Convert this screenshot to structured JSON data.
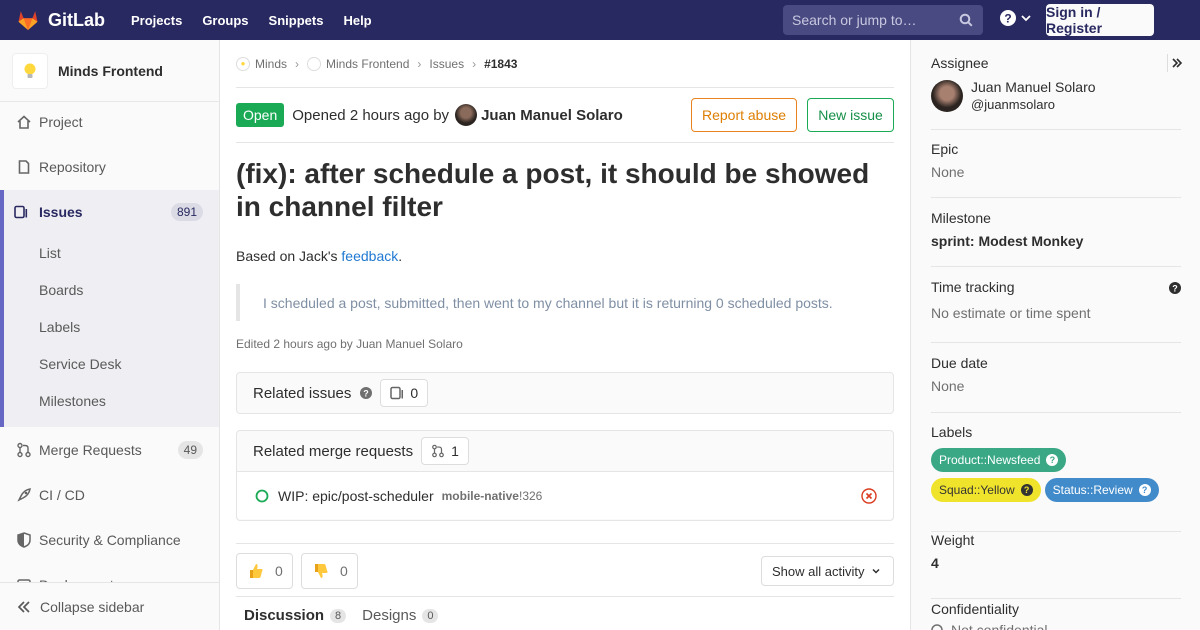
{
  "topnav": {
    "brand": "GitLab",
    "links": [
      "Projects",
      "Groups",
      "Snippets",
      "Help"
    ],
    "search_placeholder": "Search or jump to…",
    "signin_label": "Sign in / Register"
  },
  "sidebar": {
    "project_name": "Minds Frontend",
    "items": [
      {
        "label": "Project",
        "icon": "home-icon"
      },
      {
        "label": "Repository",
        "icon": "doc-icon"
      }
    ],
    "issues": {
      "label": "Issues",
      "count": "891",
      "sub": [
        "List",
        "Boards",
        "Labels",
        "Service Desk",
        "Milestones"
      ]
    },
    "after": [
      {
        "label": "Merge Requests",
        "count": "49"
      },
      {
        "label": "CI / CD"
      },
      {
        "label": "Security & Compliance"
      },
      {
        "label": "Deployments"
      }
    ],
    "collapse_label": "Collapse sidebar"
  },
  "breadcrumb": {
    "group": "Minds",
    "project": "Minds Frontend",
    "section": "Issues",
    "current": "#1843"
  },
  "issue": {
    "status": "Open",
    "opened_text": "Opened",
    "opened_time": "2 hours ago",
    "by_text": "by",
    "author": "Juan Manuel Solaro",
    "report_label": "Report abuse",
    "new_label": "New issue",
    "title": "(fix): after schedule a post, it should be showed in channel filter",
    "desc_prefix": "Based on Jack's ",
    "desc_link": "feedback",
    "desc_suffix": ".",
    "quote": "I scheduled a post, submitted, then went to my channel but it is returning 0 scheduled posts.",
    "edited": "Edited 2 hours ago by Juan Manuel Solaro"
  },
  "related_issues": {
    "label": "Related issues",
    "count": "0"
  },
  "related_mrs": {
    "label": "Related merge requests",
    "count": "1",
    "items": [
      {
        "title": "WIP: epic/post-scheduler",
        "project": "mobile-native",
        "ref": "!326"
      }
    ]
  },
  "awards": {
    "thumbsup": "0",
    "thumbsdown": "0",
    "activity_label": "Show all activity"
  },
  "tabs": [
    {
      "label": "Discussion",
      "count": "8"
    },
    {
      "label": "Designs",
      "count": "0"
    }
  ],
  "right": {
    "assignee_label": "Assignee",
    "assignee_name": "Juan Manuel Solaro",
    "assignee_user": "@juanmsolaro",
    "epic_label": "Epic",
    "epic_value": "None",
    "milestone_label": "Milestone",
    "milestone_value": "sprint: Modest Monkey",
    "time_label": "Time tracking",
    "time_value": "No estimate or time spent",
    "due_label": "Due date",
    "due_value": "None",
    "labels_label": "Labels",
    "labels": [
      {
        "text": "Product::Newsfeed",
        "bg": "#3aa885",
        "fg": "#ffffff"
      },
      {
        "text": "Squad::Yellow",
        "bg": "#f0e32b",
        "fg": "#333333"
      },
      {
        "text": "Status::Review",
        "bg": "#428bca",
        "fg": "#ffffff"
      }
    ],
    "weight_label": "Weight",
    "weight_value": "4",
    "conf_label": "Confidentiality",
    "conf_value": "Not confidential"
  }
}
